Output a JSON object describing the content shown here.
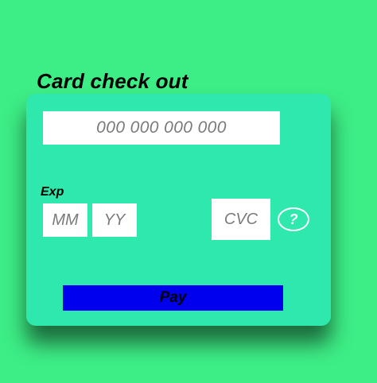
{
  "page": {
    "title": "Card check out"
  },
  "form": {
    "card_number_placeholder": "000 000 000 000",
    "exp_label": "Exp",
    "exp_month_placeholder": "MM",
    "exp_year_placeholder": "YY",
    "cvc_placeholder": "CVC",
    "help_icon": "question-mark-icon",
    "help_glyph": "?",
    "pay_label": "Pay"
  },
  "colors": {
    "background": "#3ded85",
    "card_panel": "#2ee8ad",
    "field": "#ffffff",
    "pay_button": "#0000ee",
    "text": "#000000",
    "placeholder": "#7a7a7a"
  }
}
